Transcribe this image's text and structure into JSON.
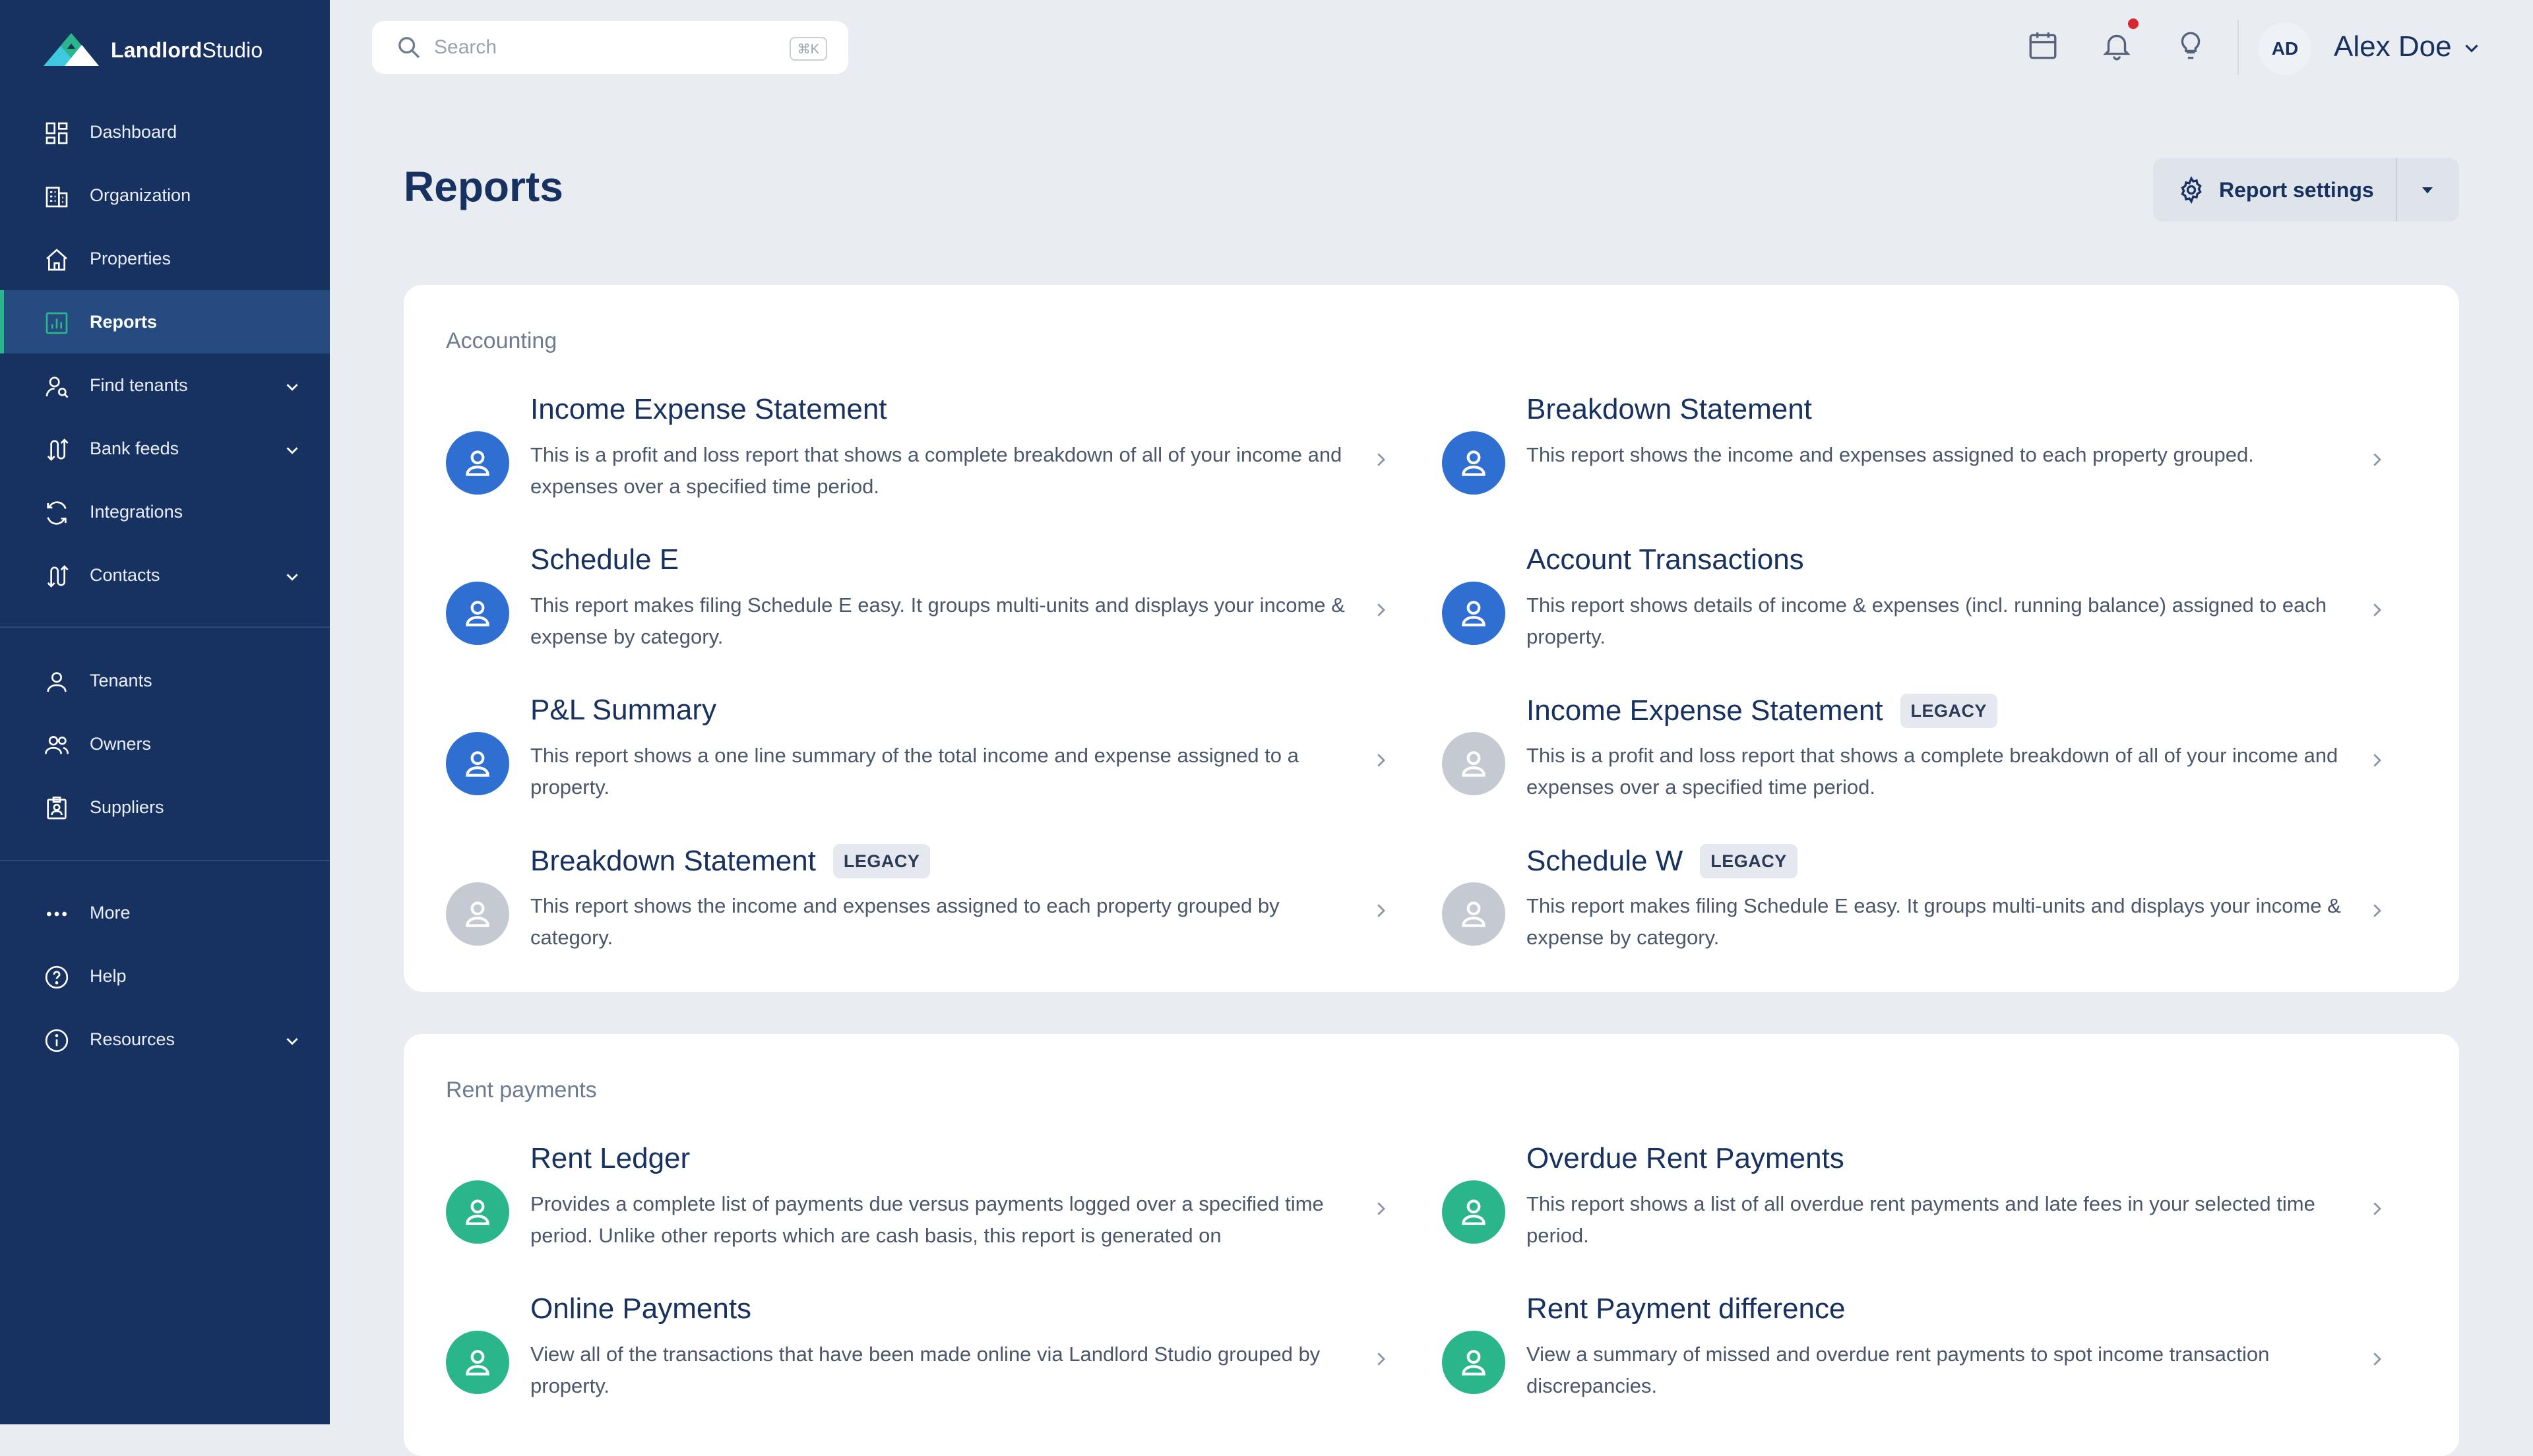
{
  "brand": {
    "name_bold": "Landlord",
    "name_regular": "Studio"
  },
  "colors": {
    "sidebar": "#173160",
    "accent_green": "#2bb58a",
    "report_blue": "#2f6fd1",
    "report_gray": "#c5c9d1",
    "notification": "#d7262e"
  },
  "sidebar": {
    "primary": [
      {
        "label": "Dashboard",
        "icon": "dashboard-icon"
      },
      {
        "label": "Organization",
        "icon": "building-icon"
      },
      {
        "label": "Properties",
        "icon": "home-icon"
      },
      {
        "label": "Reports",
        "icon": "reports-icon",
        "active": true
      },
      {
        "label": "Find tenants",
        "icon": "find-tenant-icon",
        "expandable": true
      },
      {
        "label": "Bank feeds",
        "icon": "bank-feeds-icon",
        "expandable": true
      },
      {
        "label": "Integrations",
        "icon": "sync-icon"
      },
      {
        "label": "Contacts",
        "icon": "contacts-icon",
        "expandable": true
      }
    ],
    "people": [
      {
        "label": "Tenants",
        "icon": "person-icon"
      },
      {
        "label": "Owners",
        "icon": "people-icon"
      },
      {
        "label": "Suppliers",
        "icon": "badge-icon"
      }
    ],
    "footer": [
      {
        "label": "More",
        "icon": "more-icon"
      },
      {
        "label": "Help",
        "icon": "help-icon"
      },
      {
        "label": "Resources",
        "icon": "info-icon",
        "expandable": true
      }
    ]
  },
  "topbar": {
    "search_placeholder": "Search",
    "shortcut": "⌘K",
    "user_initials": "AD",
    "user_name": "Alex Doe"
  },
  "page": {
    "title": "Reports",
    "settings_label": "Report settings"
  },
  "sections": [
    {
      "title": "Accounting",
      "reports": [
        {
          "title": "Income Expense Statement",
          "desc": "This is a profit and loss report that shows a complete breakdown of all of your income and expenses over a specified time period.",
          "legacy": false,
          "color": "blue"
        },
        {
          "title": "Breakdown Statement",
          "desc": "This report shows the income and expenses assigned to each property grouped.",
          "legacy": false,
          "color": "blue"
        },
        {
          "title": "Schedule E",
          "desc": "This report makes filing Schedule E easy. It groups multi-units and displays your income & expense by category.",
          "legacy": false,
          "color": "blue"
        },
        {
          "title": "Account Transactions",
          "desc": "This report shows details of income & expenses (incl. running balance) assigned to each property.",
          "legacy": false,
          "color": "blue"
        },
        {
          "title": "P&L Summary",
          "desc": "This report shows a one line summary of the total income and expense assigned to a property.",
          "legacy": false,
          "color": "blue"
        },
        {
          "title": "Income Expense Statement",
          "desc": "This is a profit and loss report that shows a complete breakdown of all of your income and expenses over a specified time period.",
          "legacy": true,
          "badge": "LEGACY",
          "color": "gray"
        },
        {
          "title": "Breakdown Statement",
          "desc": "This report shows the income and expenses assigned to each property grouped by category.",
          "legacy": true,
          "badge": "LEGACY",
          "color": "gray"
        },
        {
          "title": "Schedule W",
          "desc": "This report makes filing Schedule E easy. It groups multi-units and displays your income & expense by category.",
          "legacy": true,
          "badge": "LEGACY",
          "color": "gray"
        }
      ]
    },
    {
      "title": "Rent payments",
      "reports": [
        {
          "title": "Rent Ledger",
          "desc": "Provides a complete list of payments due versus payments logged over a specified time period. Unlike other reports which are cash basis, this report is generated on",
          "legacy": false,
          "color": "green"
        },
        {
          "title": "Overdue Rent Payments",
          "desc": "This report shows a list of all overdue rent payments and late fees in your selected time period.",
          "legacy": false,
          "color": "green"
        },
        {
          "title": "Online Payments",
          "desc": "View all of the transactions that have been made online via Landlord Studio grouped by property.",
          "legacy": false,
          "color": "green"
        },
        {
          "title": "Rent Payment difference",
          "desc": "View a summary of missed and overdue rent payments to spot income transaction discrepancies.",
          "legacy": false,
          "color": "green"
        }
      ]
    }
  ]
}
